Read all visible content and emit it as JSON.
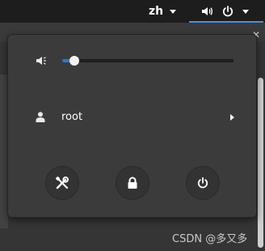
{
  "top_bar": {
    "language": "zh",
    "language_icon": "chevron-down-icon",
    "volume_icon": "speaker-icon",
    "power_icon": "power-icon",
    "system_menu_icon": "chevron-down-icon"
  },
  "volume": {
    "icon": "speaker-low-icon",
    "level": 0.07
  },
  "user": {
    "icon": "person-icon",
    "name": "root",
    "submenu_icon": "chevron-right-icon"
  },
  "actions": [
    {
      "icon": "settings-tools-icon"
    },
    {
      "icon": "lock-icon"
    },
    {
      "icon": "power-icon"
    }
  ],
  "watermark": "CSDN @多又多",
  "colors": {
    "accent": "#2a76c6",
    "panel": "#1d1d1d",
    "menu": "#3b3b3b"
  }
}
